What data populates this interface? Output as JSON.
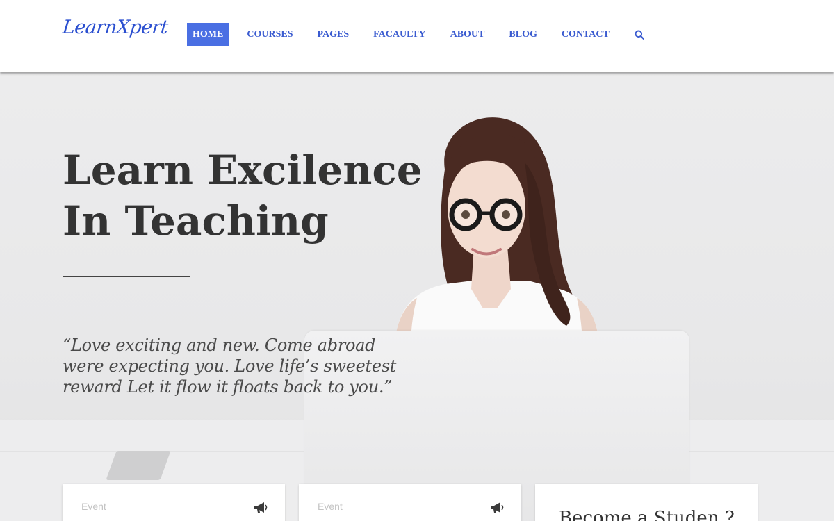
{
  "header": {
    "logo": "LearnXpert",
    "nav": [
      {
        "label": "HOME",
        "active": true
      },
      {
        "label": "COURSES"
      },
      {
        "label": "PAGES"
      },
      {
        "label": "FACAULTY"
      },
      {
        "label": "ABOUT"
      },
      {
        "label": "BLOG"
      },
      {
        "label": "CONTACT"
      }
    ],
    "search_icon": "search-icon"
  },
  "hero": {
    "headline_line1": "Learn Excilence",
    "headline_line2": "In Teaching",
    "quote": "“Love exciting and new. Come abroad were expecting you. Love life’s sweetest reward Let it flow it floats back to you.”"
  },
  "cards": [
    {
      "label": "Event",
      "icon": "megaphone-icon"
    },
    {
      "label": "Event",
      "icon": "megaphone-icon"
    },
    {
      "title": "Become a Studen ?"
    }
  ],
  "colors": {
    "accent": "#4a6fe3",
    "nav_text": "#3a5bd0",
    "heading": "#333333"
  }
}
